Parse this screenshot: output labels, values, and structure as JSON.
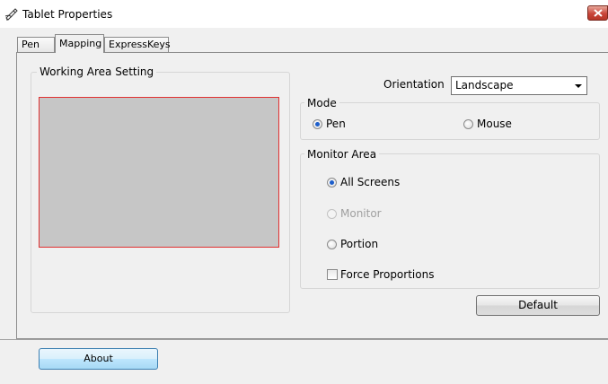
{
  "window": {
    "title": "Tablet Properties"
  },
  "tabs": [
    {
      "label": "Pen",
      "active": false
    },
    {
      "label": "Mapping",
      "active": true
    },
    {
      "label": "ExpressKeys",
      "active": false
    }
  ],
  "working_area": {
    "label": "Working Area Setting"
  },
  "orientation": {
    "label": "Orientation",
    "value": "Landscape"
  },
  "mode": {
    "label": "Mode",
    "options": [
      {
        "label": "Pen",
        "checked": true
      },
      {
        "label": "Mouse",
        "checked": false
      }
    ]
  },
  "monitor_area": {
    "label": "Monitor Area",
    "options": [
      {
        "label": "All Screens",
        "checked": true,
        "enabled": true
      },
      {
        "label": "Monitor",
        "checked": false,
        "enabled": false
      },
      {
        "label": "Portion",
        "checked": false,
        "enabled": true
      }
    ],
    "force_proportions": {
      "label": "Force Proportions",
      "checked": false
    }
  },
  "buttons": {
    "default": "Default",
    "about": "About"
  },
  "colors": {
    "preview_fill": "#c6c6c6",
    "preview_border": "#e03030",
    "radio_dot": "#1d5ecb",
    "close_button": "#c9453a"
  }
}
